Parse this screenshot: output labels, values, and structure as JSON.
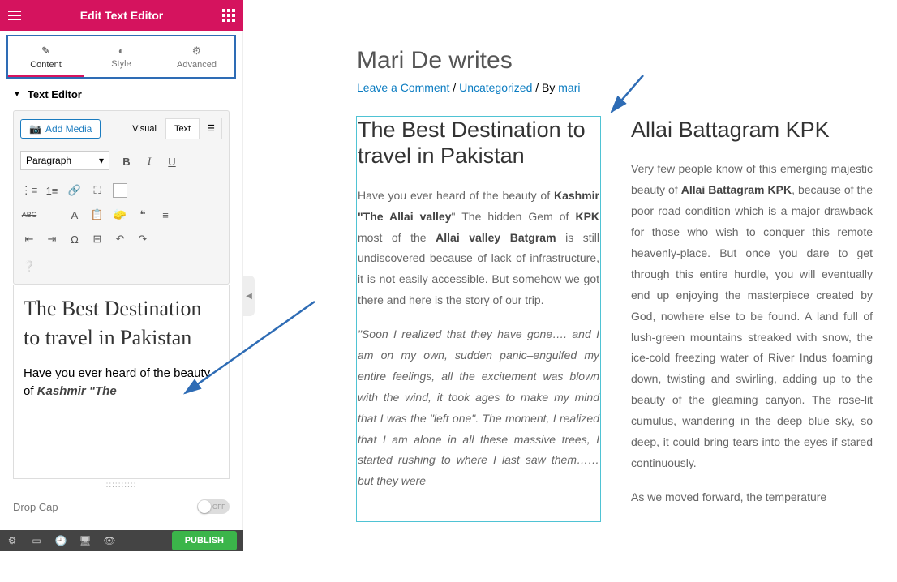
{
  "header": {
    "title": "Edit Text Editor"
  },
  "tabs": {
    "content": "Content",
    "style": "Style",
    "advanced": "Advanced"
  },
  "section": {
    "title": "Text Editor"
  },
  "toolbar": {
    "add_media": "Add Media",
    "visual": "Visual",
    "text": "Text",
    "format": "Paragraph"
  },
  "editor": {
    "heading": "The Best Destination to travel in Pakistan",
    "p1_a": "Have you ever heard of the beauty of ",
    "p1_b": "Kashmir \"The"
  },
  "dropcap": {
    "label": "Drop Cap",
    "state": "OFF"
  },
  "publish": "PUBLISH",
  "page": {
    "title": "Mari De writes",
    "leave_comment": "Leave a Comment",
    "sep1": " / ",
    "uncategorized": "Uncategorized",
    "by": " / By ",
    "author": "mari"
  },
  "col1": {
    "h": "The Best Destination to travel in Pakistan",
    "p1_a": "Have you ever heard of the beauty of ",
    "p1_b": "Kashmir \"The Allai valley",
    "p1_c": "\" The hidden Gem of ",
    "p1_d": "KPK",
    "p1_e": " most of the ",
    "p1_f": "Allai valley Batgram",
    "p1_g": " is still undiscovered because of lack of infrastructure, it is not easily accessible. But somehow we got there and here is the story of our trip.",
    "p2": "\"Soon I realized that they have gone…. and I am on my own, sudden panic–engulfed my entire feelings, all the excitement was blown with the wind, it took ages to make my mind that I was the \"left one\". The moment, I realized that I am alone in all these massive trees, I started rushing to where I last saw them…… but they were"
  },
  "col2": {
    "h": "Allai Battagram KPK",
    "p1_a": "Very few people know of this emerging majestic beauty of ",
    "p1_b": "Allai Battagram KPK",
    "p1_c": ", because of the poor road condition which is a major drawback for those who wish to conquer this remote heavenly-place. But once you dare to get through this entire hurdle, you will eventually end up enjoying the masterpiece created by God, nowhere else to be found. A land full of lush-green mountains streaked with snow, the ice-cold freezing water of River Indus foaming down, twisting and swirling, adding up to the beauty of the gleaming canyon. The rose-lit cumulus, wandering in the deep blue sky, so deep, it could bring tears into the eyes if stared continuously.",
    "p2": "  As we moved forward, the temperature"
  }
}
